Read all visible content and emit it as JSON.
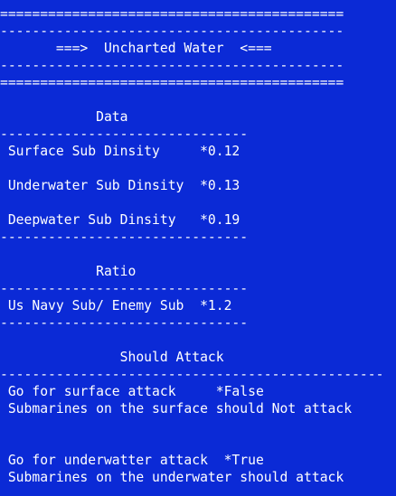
{
  "console": {
    "lines": [
      "===========================================",
      "-------------------------------------------",
      "       ===>  Uncharted Water  <===",
      "-------------------------------------------",
      "===========================================",
      "",
      "            Data",
      "-------------------------------",
      " Surface Sub Dinsity     *0.12",
      "",
      " Underwater Sub Dinsity  *0.13",
      "",
      " Deepwater Sub Dinsity   *0.19",
      "-------------------------------",
      "",
      "            Ratio",
      "-------------------------------",
      " Us Navy Sub/ Enemy Sub  *1.2",
      "-------------------------------",
      "",
      "               Should Attack",
      "------------------------------------------------",
      " Go for surface attack     *False",
      " Submarines on the surface should Not attack",
      "",
      "",
      " Go for underwatter attack  *True",
      " Submarines on the underwater should attack"
    ]
  },
  "colors": {
    "background": "#0b2ad6",
    "text": "#ffffff"
  }
}
